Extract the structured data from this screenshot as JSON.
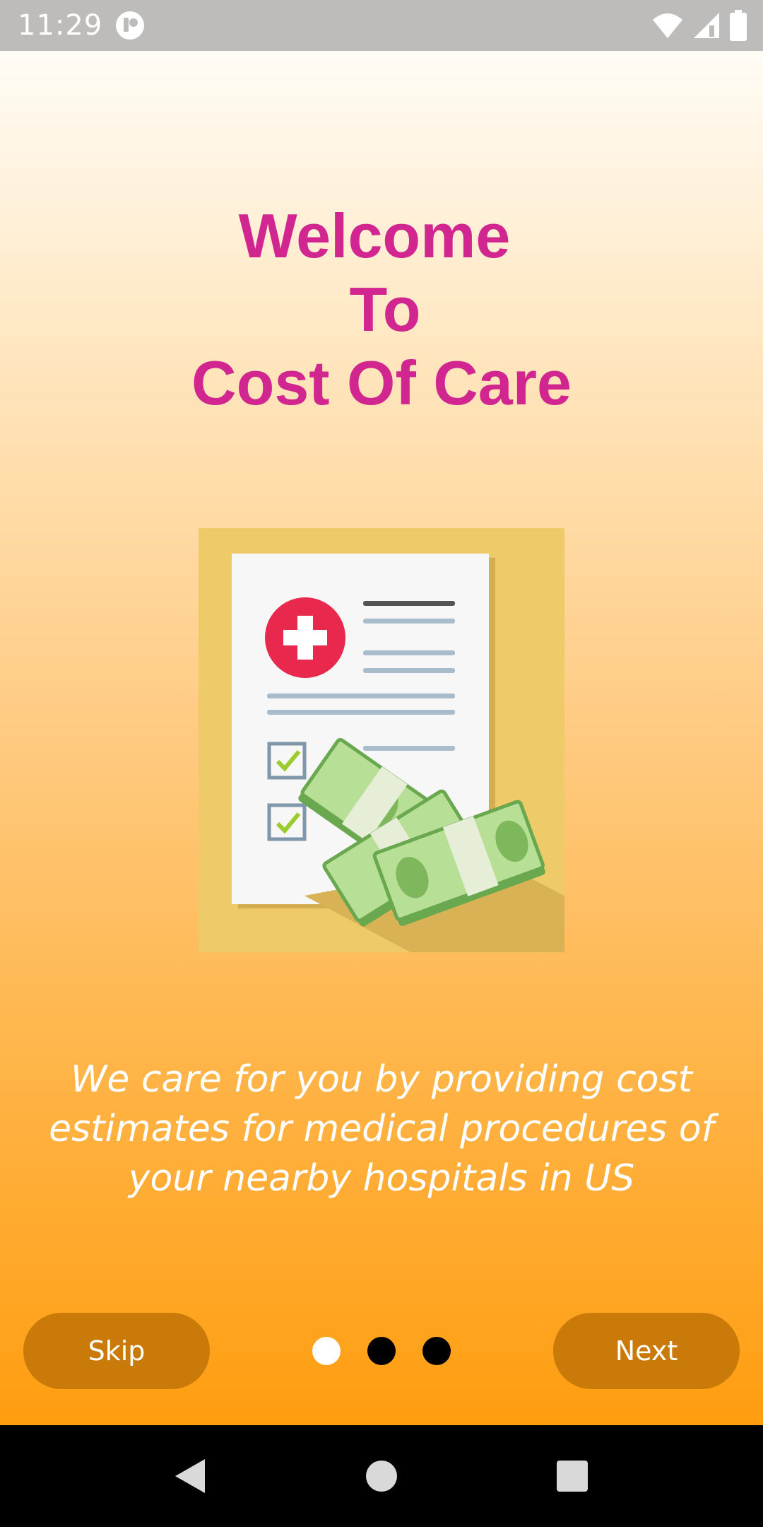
{
  "status_bar": {
    "time": "11:29",
    "icons": [
      "app-notification-icon",
      "wifi-icon",
      "cell-signal-icon",
      "battery-icon"
    ]
  },
  "onboarding": {
    "title_lines": [
      "Welcome",
      "To",
      "Cost Of Care"
    ],
    "illustration": "medical-bill-with-cash-illustration",
    "tagline": "We care for you by providing cost estimates for medical procedures of your nearby hospitals in US",
    "skip_label": "Skip",
    "next_label": "Next",
    "page_indicator": {
      "current": 1,
      "total": 3
    }
  },
  "nav_bar": {
    "icons": [
      "back-icon",
      "home-icon",
      "recents-icon"
    ]
  },
  "colors": {
    "title": "#d12590",
    "button_bg": "#c97a09",
    "gradient_top": "#fffcf6",
    "gradient_bottom": "#ff9d0f",
    "status_bar_bg": "#bdbcbb"
  }
}
